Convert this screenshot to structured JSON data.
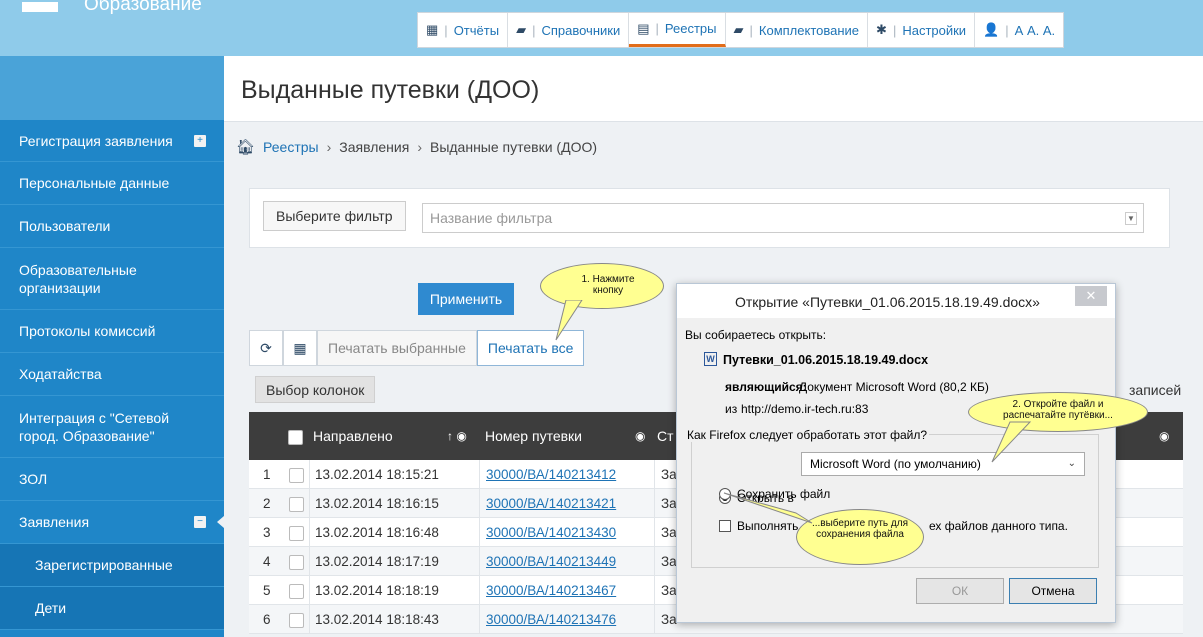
{
  "logo": {
    "text": "Образование"
  },
  "tabs": [
    {
      "icon": "reports-icon",
      "glyph": "▦",
      "label": "Отчёты"
    },
    {
      "icon": "book-icon",
      "glyph": "▰",
      "label": "Справочники"
    },
    {
      "icon": "registry-icon",
      "glyph": "▤",
      "label": "Реестры",
      "active": true
    },
    {
      "icon": "book-icon",
      "glyph": "▰",
      "label": "Комплектование"
    },
    {
      "icon": "gear-icon",
      "glyph": "✱",
      "label": "Настройки"
    },
    {
      "icon": "user-icon",
      "glyph": "👤",
      "label": "А А. А."
    }
  ],
  "sidebar": {
    "items": [
      {
        "label": "Регистрация заявления",
        "toggle": "+"
      },
      {
        "label": "Персональные данные"
      },
      {
        "label": "Пользователи"
      },
      {
        "label": "Образовательные организации"
      },
      {
        "label": "Протоколы комиссий"
      },
      {
        "label": "Ходатайства"
      },
      {
        "label": "Интеграция с \"Сетевой город. Образование\""
      },
      {
        "label": "ЗОЛ"
      },
      {
        "label": "Заявления",
        "toggle": "−"
      },
      {
        "label": "Зарегистрированные",
        "sub": true
      },
      {
        "label": "Дети",
        "sub": true
      }
    ]
  },
  "page": {
    "title": "Выданные путевки (ДОО)"
  },
  "breadcrumb": {
    "home": "Реестры",
    "mid": "Заявления",
    "current": "Выданные путевки (ДОО)"
  },
  "filter": {
    "label": "Выберите фильтр",
    "placeholder": "Название фильтра"
  },
  "buttons": {
    "apply": "Применить",
    "print_selected": "Печатать выбранные",
    "print_all": "Печатать все",
    "columns": "Выбор колонок"
  },
  "records_label": "записей",
  "table": {
    "headers": {
      "sent": "Направлено",
      "number": "Номер путевки",
      "status": "Ст"
    },
    "rows": [
      {
        "n": "1",
        "date": "13.02.2014 18:15:21",
        "number": "30000/ВА/140213412",
        "status": "За"
      },
      {
        "n": "2",
        "date": "13.02.2014 18:16:15",
        "number": "30000/ВА/140213421",
        "status": "За"
      },
      {
        "n": "3",
        "date": "13.02.2014 18:16:48",
        "number": "30000/ВА/140213430",
        "status": "За"
      },
      {
        "n": "4",
        "date": "13.02.2014 18:17:19",
        "number": "30000/ВА/140213449",
        "status": "За"
      },
      {
        "n": "5",
        "date": "13.02.2014 18:18:19",
        "number": "30000/ВА/140213467",
        "status": "За"
      },
      {
        "n": "6",
        "date": "13.02.2014 18:18:43",
        "number": "30000/ВА/140213476",
        "status": "За"
      }
    ]
  },
  "dialog": {
    "title": "Открытие «Путевки_01.06.2015.18.19.49.docx»",
    "intro": "Вы собираетесь открыть:",
    "filename": "Путевки_01.06.2015.18.19.49.docx",
    "type_label": "являющийся:",
    "type_value": "Документ Microsoft Word (80,2 КБ)",
    "from_label": "из",
    "from_value": "http://demo.ir-tech.ru:83",
    "question": "Как Firefox следует обработать этот файл?",
    "open_with": "Открыть в",
    "app": "Microsoft Word (по умолчанию)",
    "save_file": "Сохранить файл",
    "auto_prefix": "Выполнять",
    "auto_suffix": "ех файлов данного типа.",
    "ok": "ОК",
    "cancel": "Отмена"
  },
  "callouts": {
    "c1": "1. Нажмите кнопку",
    "c2": "2. Откройте файл и распечатайте путёвки...",
    "c3": "...выберите путь для сохранения файла"
  }
}
